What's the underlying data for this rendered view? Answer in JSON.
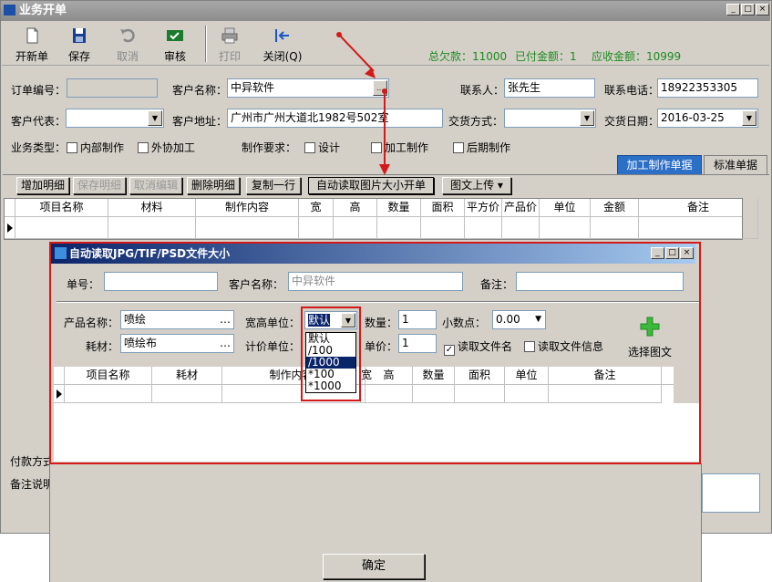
{
  "window": {
    "title": "业务开单"
  },
  "toolbar": {
    "new_label": "开新单",
    "save_label": "保存",
    "cancel_label": "取消",
    "audit_label": "审核",
    "print_label": "打印",
    "close_label": "关闭(Q)",
    "total_owed": "总欠款：11000",
    "paid": "已付金额：1",
    "receivable": "应收金额：10999"
  },
  "form": {
    "order_no_label": "订单编号：",
    "order_no": "",
    "customer_label": "客户名称：",
    "customer": "中异软件",
    "contact_label": "联系人：",
    "contact": "张先生",
    "phone_label": "联系电话：",
    "phone": "18922353305",
    "rep_label": "客户代表：",
    "rep": "",
    "address_label": "客户地址：",
    "address": "广州市广州大道北1982号502室",
    "delivery_label": "交货方式：",
    "delivery": "",
    "date_label": "交货日期：",
    "date": "2016-03-25",
    "biztype_label": "业务类型：",
    "internal": "内部制作",
    "outsource": "外协加工",
    "req_label": "制作要求：",
    "design": "设计",
    "process": "加工制作",
    "post": "后期制作"
  },
  "tabs": {
    "process_tab": "加工制作单据",
    "standard_tab": "标准单据"
  },
  "actions": {
    "add": "增加明细",
    "save": "保存明细",
    "cancel_edit": "取消编辑",
    "delete": "删除明细",
    "copy_row": "复制一行",
    "auto_read": "自动读取图片大小开单",
    "upload": "图文上传"
  },
  "main_grid": {
    "columns": [
      "项目名称",
      "材料",
      "制作内容",
      "宽",
      "高",
      "数量",
      "面积",
      "平方价",
      "产品价",
      "单位",
      "金额",
      "备注"
    ]
  },
  "bottom": {
    "payment_label": "付款方式",
    "remark_label": "备注说明"
  },
  "dialog": {
    "title": "自动读取JPG/TIF/PSD文件大小",
    "no_label": "单号：",
    "no": "",
    "customer_label": "客户名称：",
    "customer_placeholder": "中异软件",
    "remark_label": "备注：",
    "remark": "",
    "product_label": "产品名称：",
    "product": "喷绘",
    "wh_unit_label": "宽高单位：",
    "wh_unit": "默认",
    "qty_label": "数量：",
    "qty": "1",
    "decimal_label": "小数点：",
    "decimal": "0.00",
    "material_label": "耗材：",
    "material": "喷绘布",
    "price_unit_label": "计价单位：",
    "unit_price_label": "单价：",
    "unit_price": "1",
    "read_filename": "读取文件名",
    "read_fileinfo": "读取文件信息",
    "select_image": "选择图文",
    "confirm": "确定",
    "dropdown_options": [
      "默认",
      "/100",
      "/1000",
      "*100",
      "*1000"
    ],
    "columns": [
      "项目名称",
      "耗材",
      "制作内容",
      "宽",
      "高",
      "数量",
      "面积",
      "单位",
      "备注"
    ]
  }
}
